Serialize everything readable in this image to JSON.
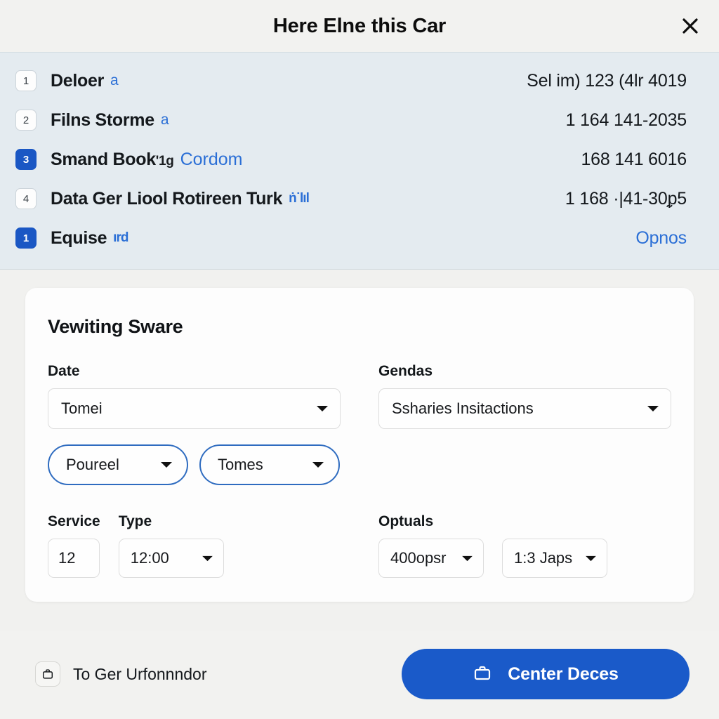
{
  "header": {
    "title": "Here Elne this Car",
    "close_label": "×"
  },
  "list": {
    "rows": [
      {
        "badge": "1",
        "badge_style": "light",
        "label": "Deloer",
        "link": "a",
        "value": "Sel im) 123 (4lr 4019"
      },
      {
        "badge": "2",
        "badge_style": "light",
        "label": "Filns Storme",
        "link": "a",
        "value": "1 164 141-2035"
      },
      {
        "badge": "3",
        "badge_style": "accent",
        "label": "Smand Book",
        "label_sub": "'1g",
        "link": "Cordom",
        "value": "168 141 6016"
      },
      {
        "badge": "4",
        "badge_style": "light",
        "label": "Data Ger Liool Rotireen Turk",
        "link": "ṅ˙lıl",
        "value": "1 168 ·|41-30ᵱ5"
      },
      {
        "badge": "1",
        "badge_style": "accent",
        "label": "Equise",
        "link": "ırd",
        "value": "Opnos",
        "value_is_link": true
      }
    ]
  },
  "card": {
    "title": "Vewiting Sware",
    "fields": {
      "date_label": "Date",
      "date_value": "Tomei",
      "gendas_label": "Gendas",
      "gendas_value": "Ssharies Insitactions",
      "pill_one": "Poureel",
      "pill_two": "Tomes",
      "service_label": "Service",
      "service_value": "12",
      "type_label": "Type",
      "type_value": "12:00",
      "optuals_label": "Optuals",
      "optuals_value_one": "400opsr",
      "optuals_value_two": "1:3 Japs"
    }
  },
  "footer": {
    "secondary_label": "To Ger Urfonnndor",
    "primary_label": "Center Deces"
  },
  "colors": {
    "accent": "#1a5ac9",
    "link": "#2b6fd6",
    "list_bg": "#e4ebf0",
    "page_bg": "#f1f1ef"
  }
}
